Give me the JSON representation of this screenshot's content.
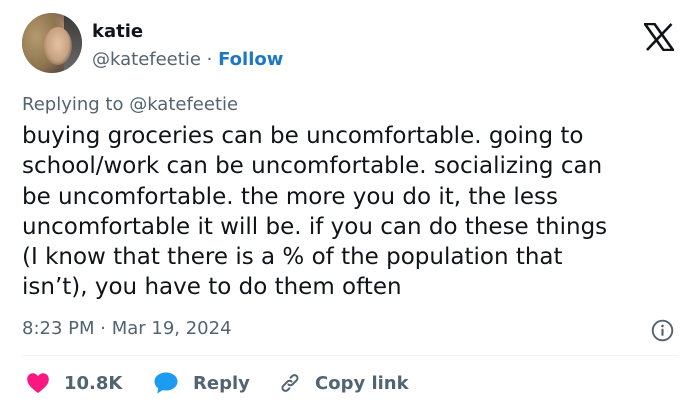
{
  "author": {
    "name": "katie",
    "handle": "@katefeetie",
    "separator": "·",
    "follow_label": "Follow"
  },
  "reply_context": {
    "prefix": "Replying to ",
    "handle": "@katefeetie"
  },
  "tweet": {
    "text": "buying groceries can be uncomfortable. going to\nschool/work can be uncomfortable. socializing can\nbe uncomfortable. the more you do it, the less\nuncomfortable it will be. if you can do these things\n(I know that there is a % of the population that\nisn’t), you have to do them often",
    "timestamp": "8:23 PM · Mar 19, 2024"
  },
  "actions": {
    "like_count": "10.8K",
    "reply_label": "Reply",
    "copy_link_label": "Copy link"
  },
  "icons": {
    "logo": "x-logo-icon",
    "info": "info-icon",
    "like": "heart-icon",
    "reply": "speech-bubble-icon",
    "copy": "link-icon"
  },
  "colors": {
    "text": "#0f1419",
    "secondary": "#536471",
    "link": "#1d77c2",
    "heart": "#f91880",
    "reply": "#1d9bf0"
  }
}
